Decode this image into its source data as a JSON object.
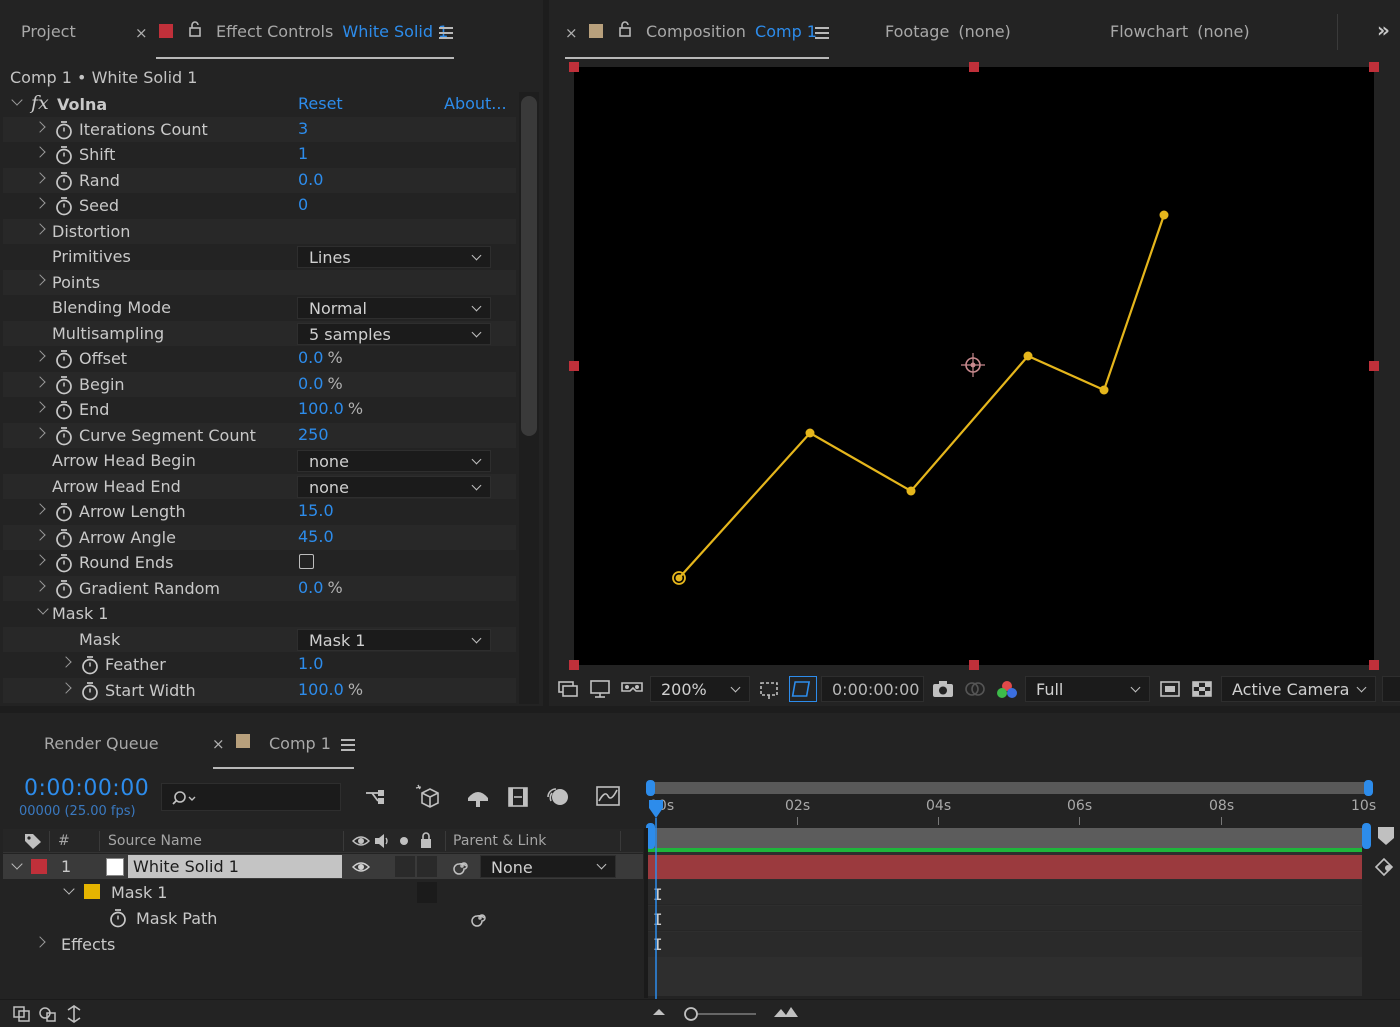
{
  "effect_controls_panel": {
    "tabs": {
      "project": "Project",
      "effect_controls_prefix": "Effect Controls",
      "effect_controls_layer": "White Solid 1"
    },
    "breadcrumb": "Comp 1 • White Solid 1",
    "effect": {
      "fx_label": "fx",
      "name": "Volna",
      "reset_label": "Reset",
      "about_label": "About..."
    },
    "properties": {
      "iterations_count": {
        "label": "Iterations Count",
        "value": "3"
      },
      "shift": {
        "label": "Shift",
        "value": "1"
      },
      "rand": {
        "label": "Rand",
        "value": "0.0"
      },
      "seed": {
        "label": "Seed",
        "value": "0"
      },
      "distortion": {
        "label": "Distortion"
      },
      "primitives": {
        "label": "Primitives",
        "value": "Lines"
      },
      "points": {
        "label": "Points"
      },
      "blending_mode": {
        "label": "Blending Mode",
        "value": "Normal"
      },
      "multisampling": {
        "label": "Multisampling",
        "value": "5 samples"
      },
      "offset": {
        "label": "Offset",
        "value": "0.0",
        "unit": "%"
      },
      "begin": {
        "label": "Begin",
        "value": "0.0",
        "unit": "%"
      },
      "end": {
        "label": "End",
        "value": "100.0",
        "unit": "%"
      },
      "curve_segment_count": {
        "label": "Curve Segment Count",
        "value": "250"
      },
      "arrow_head_begin": {
        "label": "Arrow Head Begin",
        "value": "none"
      },
      "arrow_head_end": {
        "label": "Arrow Head End",
        "value": "none"
      },
      "arrow_length": {
        "label": "Arrow Length",
        "value": "15.0"
      },
      "arrow_angle": {
        "label": "Arrow Angle",
        "value": "45.0"
      },
      "round_ends": {
        "label": "Round Ends",
        "checked": false
      },
      "gradient_random": {
        "label": "Gradient Random",
        "value": "0.0",
        "unit": "%"
      },
      "mask_group": {
        "label": "Mask 1"
      },
      "mask": {
        "label": "Mask",
        "value": "Mask 1"
      },
      "feather": {
        "label": "Feather",
        "value": "1.0"
      },
      "start_width": {
        "label": "Start Width",
        "value": "100.0",
        "unit": "%"
      }
    }
  },
  "composition_panel": {
    "tabs": {
      "composition_prefix": "Composition",
      "composition_name": "Comp 1",
      "footage": "Footage",
      "footage_value": "(none)",
      "flowchart": "Flowchart",
      "flowchart_value": "(none)"
    },
    "toolbar": {
      "zoom": "200%",
      "timecode": "0:00:00:00",
      "resolution": "Full",
      "camera": "Active Camera"
    },
    "mask_path_color": "#e5b61c"
  },
  "timeline_panel": {
    "tabs": {
      "render_queue": "Render Queue",
      "comp": "Comp 1"
    },
    "current_time": "0:00:00:00",
    "frame_info": "00000 (25.00 fps)",
    "columns": {
      "number": "#",
      "source_name": "Source Name",
      "parent_link": "Parent & Link"
    },
    "layers": [
      {
        "index": "1",
        "name": "White Solid 1",
        "parent": "None"
      }
    ],
    "sub_rows": {
      "mask": "Mask 1",
      "mask_path": "Mask Path",
      "effects": "Effects"
    },
    "ruler": [
      "00s",
      "02s",
      "04s",
      "06s",
      "08s",
      "10s"
    ],
    "colors": {
      "accent": "#2d8ceb",
      "layer_label": "#c0303a",
      "mask_label": "#e5b400",
      "layer_bar": "#9b3a3e",
      "work_area": "#1fb53b"
    }
  }
}
